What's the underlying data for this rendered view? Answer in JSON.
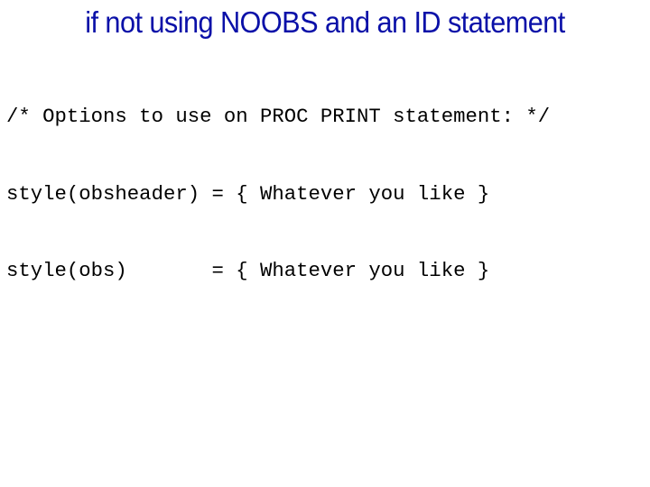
{
  "slide": {
    "title": "if not using NOOBS and an ID statement",
    "code_lines": [
      "/* Options to use on PROC PRINT statement: */",
      "style(obsheader) = { Whatever you like }",
      "style(obs)       = { Whatever you like }"
    ]
  }
}
